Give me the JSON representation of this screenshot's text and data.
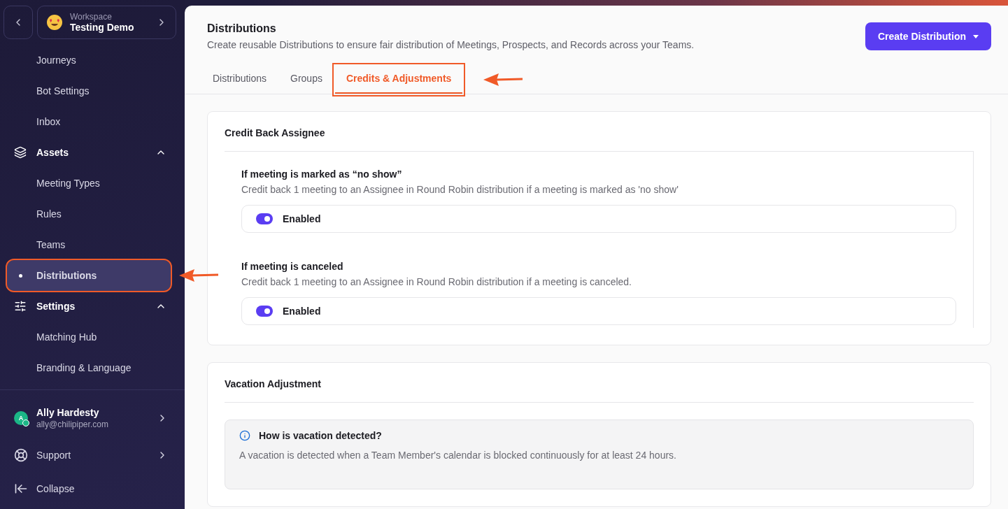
{
  "sidebar": {
    "workspace": {
      "label": "Workspace",
      "name": "Testing Demo"
    },
    "items": [
      {
        "kind": "link",
        "label": "Journeys",
        "selected": false,
        "annotated": false
      },
      {
        "kind": "link",
        "label": "Bot Settings",
        "selected": false,
        "annotated": false
      },
      {
        "kind": "link",
        "label": "Inbox",
        "selected": false,
        "annotated": false
      },
      {
        "kind": "section",
        "label": "Assets",
        "expanded": true,
        "selected": false,
        "annotated": false
      },
      {
        "kind": "link",
        "label": "Meeting Types",
        "selected": false,
        "annotated": false
      },
      {
        "kind": "link",
        "label": "Rules",
        "selected": false,
        "annotated": false
      },
      {
        "kind": "link",
        "label": "Teams",
        "selected": false,
        "annotated": false
      },
      {
        "kind": "link",
        "label": "Distributions",
        "selected": true,
        "annotated": true
      },
      {
        "kind": "section",
        "label": "Settings",
        "expanded": true,
        "selected": false,
        "annotated": false
      },
      {
        "kind": "link",
        "label": "Matching Hub",
        "selected": false,
        "annotated": false
      },
      {
        "kind": "link",
        "label": "Branding & Language",
        "selected": false,
        "annotated": false
      }
    ],
    "user": {
      "initial": "A",
      "name": "Ally Hardesty",
      "email": "ally@chilipiper.com"
    },
    "support": "Support",
    "collapse": "Collapse"
  },
  "header": {
    "title": "Distributions",
    "subtitle": "Create reusable Distributions to ensure fair distribution of Meetings, Prospects, and Records across your Teams.",
    "button": "Create Distribution"
  },
  "tabs": [
    {
      "label": "Distributions",
      "selected": false,
      "annotated": false
    },
    {
      "label": "Groups",
      "selected": false,
      "annotated": false
    },
    {
      "label": "Credits & Adjustments",
      "selected": true,
      "annotated": true
    }
  ],
  "credit_back": {
    "title": "Credit Back Assignee",
    "options": [
      {
        "title": "If meeting is marked as “no show”",
        "description": "Credit back 1 meeting to an Assignee in Round Robin distribution if a meeting is marked as 'no show'",
        "toggle_label": "Enabled",
        "on": true
      },
      {
        "title": "If meeting is canceled",
        "description": "Credit back 1 meeting to an Assignee in Round Robin distribution if a meeting is canceled.",
        "toggle_label": "Enabled",
        "on": true
      }
    ]
  },
  "vacation": {
    "title": "Vacation Adjustment",
    "info": {
      "title": "How is vacation detected?",
      "text": "A vacation is detected when a Team Member's calendar is blocked continuously for at least 24 hours."
    }
  }
}
